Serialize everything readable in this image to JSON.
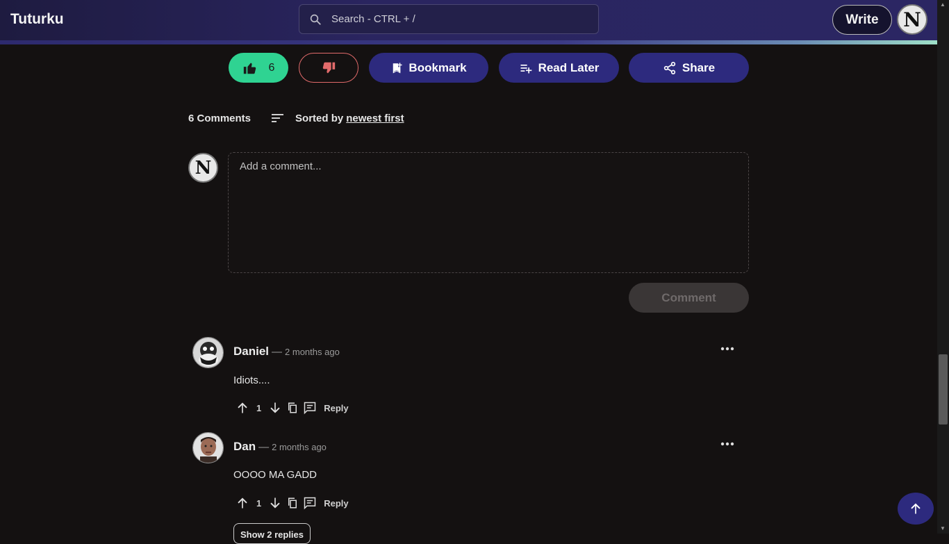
{
  "header": {
    "logo": "Tuturku",
    "search_placeholder": "Search - CTRL + /",
    "write_label": "Write",
    "avatar_letter": "N"
  },
  "actions": {
    "like_count": "6",
    "bookmark_label": "Bookmark",
    "read_later_label": "Read Later",
    "share_label": "Share",
    "colors": {
      "like": "#2fd392",
      "dislike": "#e26b6b",
      "primary": "#2d2a7e"
    }
  },
  "comments": {
    "count_label": "6 Comments",
    "sorted_by_label": "Sorted by",
    "sorted_by_value": "newest first",
    "input_placeholder": "Add a comment...",
    "submit_label": "Comment",
    "my_avatar_letter": "N",
    "items": [
      {
        "name": "Daniel",
        "dash": "—",
        "time": "2 months ago",
        "text": "Idiots....",
        "votes": "1",
        "reply_label": "Reply"
      },
      {
        "name": "Dan",
        "dash": "—",
        "time": "2 months ago",
        "text": "OOOO MA GADD",
        "votes": "1",
        "reply_label": "Reply"
      }
    ],
    "show_replies_label": "Show 2 replies"
  }
}
